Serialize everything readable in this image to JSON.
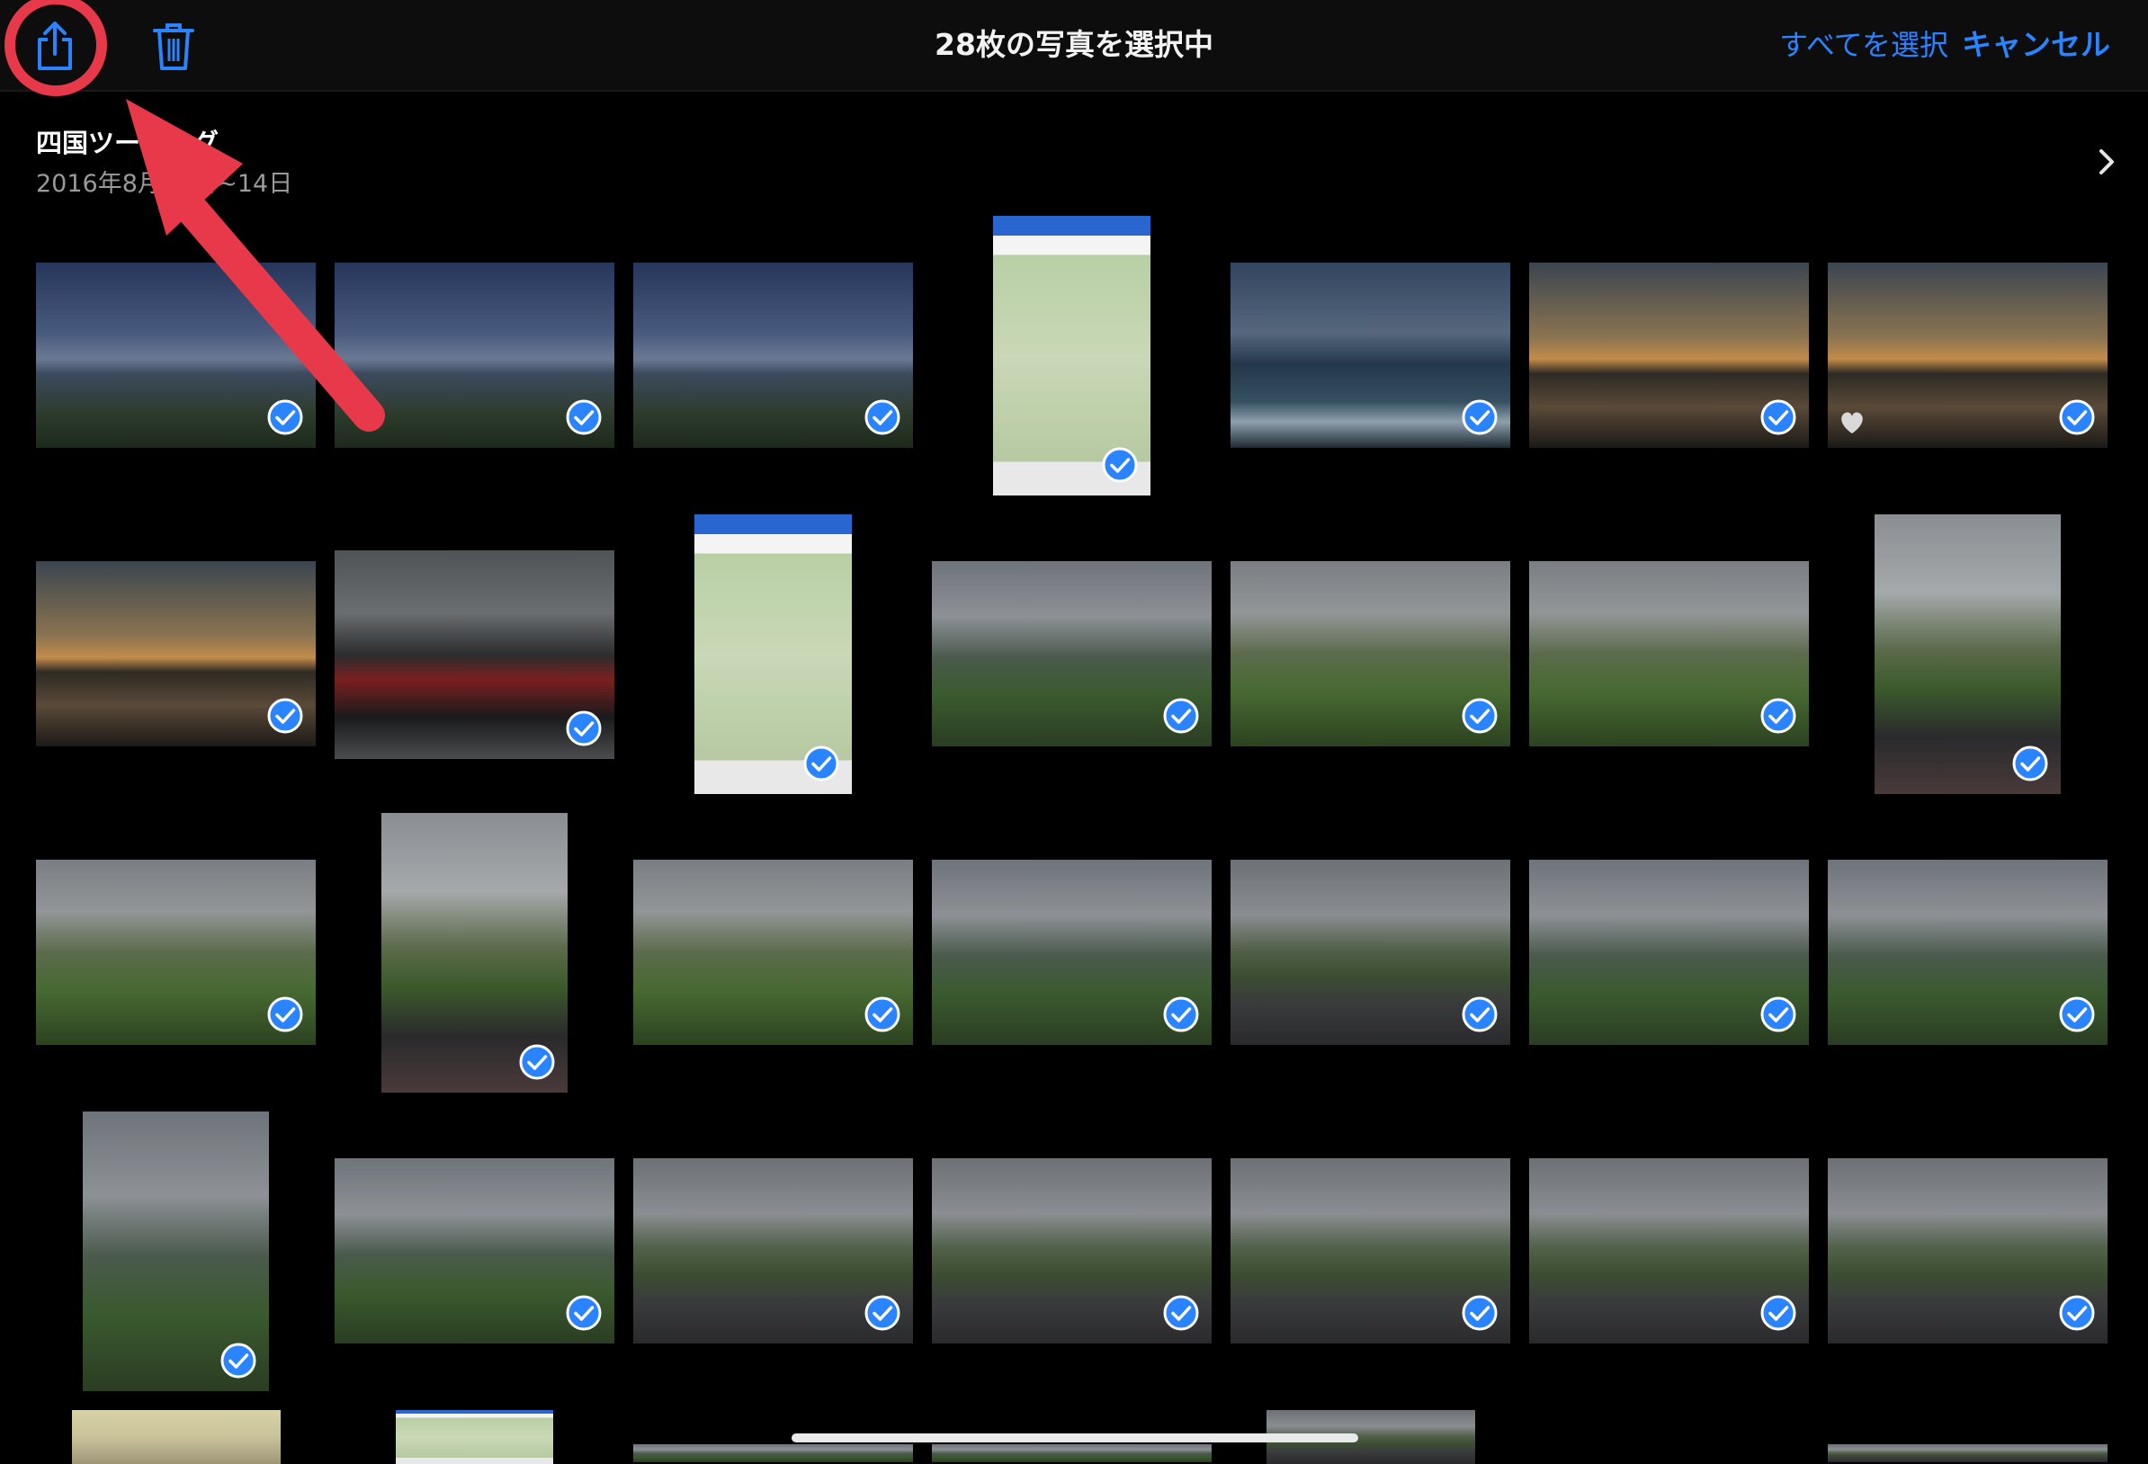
{
  "header": {
    "title": "28枚の写真を選択中",
    "select_all_label": "すべてを選択",
    "cancel_label": "キャンセル",
    "share_icon": "share-icon",
    "trash_icon": "trash-icon"
  },
  "album": {
    "title": "四国ツーリング",
    "date": "2016年8月13日~14日",
    "chevron_icon": "chevron-right-icon"
  },
  "colors": {
    "accent": "#2a84ff",
    "annotation_red": "#e8394a",
    "background": "#000000",
    "header_background": "#0d0d0d"
  },
  "selected_count": 28,
  "photos": [
    {
      "scene": "bridge",
      "selected": true,
      "favorite": false
    },
    {
      "scene": "bridge",
      "selected": true,
      "favorite": false
    },
    {
      "scene": "bridge",
      "selected": true,
      "favorite": false
    },
    {
      "scene": "map",
      "selected": true,
      "favorite": false
    },
    {
      "scene": "coast",
      "selected": true,
      "favorite": false
    },
    {
      "scene": "sunset",
      "selected": true,
      "favorite": false
    },
    {
      "scene": "sunset",
      "selected": true,
      "favorite": true
    },
    {
      "scene": "sunset",
      "selected": true,
      "favorite": false
    },
    {
      "scene": "bike",
      "selected": true,
      "favorite": false
    },
    {
      "scene": "map",
      "selected": true,
      "favorite": false
    },
    {
      "scene": "mountain",
      "selected": true,
      "favorite": false
    },
    {
      "scene": "ridge",
      "selected": true,
      "favorite": false
    },
    {
      "scene": "ridge",
      "selected": true,
      "favorite": false
    },
    {
      "scene": "bikeridge",
      "selected": true,
      "favorite": false
    },
    {
      "scene": "ridge",
      "selected": true,
      "favorite": false
    },
    {
      "scene": "bikeridge",
      "selected": true,
      "favorite": false
    },
    {
      "scene": "ridge",
      "selected": true,
      "favorite": false
    },
    {
      "scene": "mountain",
      "selected": true,
      "favorite": false
    },
    {
      "scene": "road",
      "selected": true,
      "favorite": false
    },
    {
      "scene": "mountain",
      "selected": true,
      "favorite": false
    },
    {
      "scene": "mountain",
      "selected": true,
      "favorite": false
    },
    {
      "scene": "mountain",
      "selected": true,
      "favorite": false
    },
    {
      "scene": "mountain",
      "selected": true,
      "favorite": false
    },
    {
      "scene": "road",
      "selected": true,
      "favorite": false
    },
    {
      "scene": "road",
      "selected": true,
      "favorite": false
    },
    {
      "scene": "road",
      "selected": true,
      "favorite": false
    },
    {
      "scene": "road",
      "selected": true,
      "favorite": false
    },
    {
      "scene": "road",
      "selected": true,
      "favorite": false
    },
    {
      "scene": "indoor",
      "selected": false,
      "favorite": false
    },
    {
      "scene": "map",
      "selected": false,
      "favorite": false
    },
    {
      "scene": "mountain",
      "selected": false,
      "favorite": false
    },
    {
      "scene": "mountain",
      "selected": false,
      "favorite": false
    },
    {
      "scene": "road",
      "selected": false,
      "favorite": false
    },
    {
      "scene": "road",
      "selected": false,
      "favorite": false
    }
  ],
  "annotation": {
    "type": "red circle and arrow highlighting share-icon"
  }
}
